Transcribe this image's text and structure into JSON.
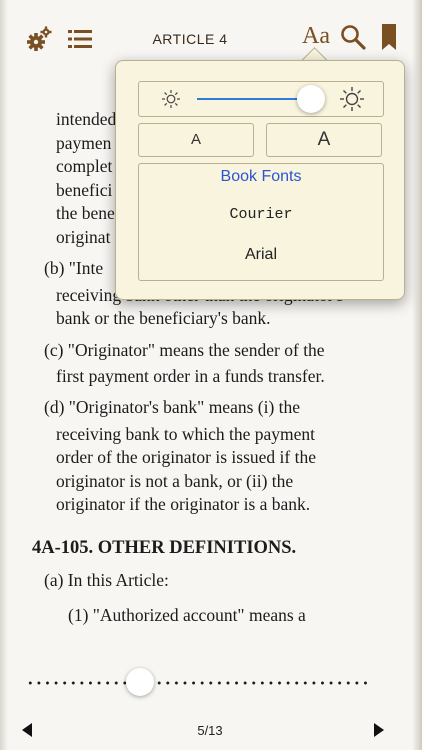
{
  "toolbar": {
    "title": "ARTICLE 4",
    "font_button_label": "Aa"
  },
  "content_lines": [
    "intended",
    "paymen",
    "complet",
    "benefici",
    "the bene",
    "originat",
    "(b)  \"Inte",
    "receiving bank other than the originator's",
    "bank or the beneficiary's bank.",
    "(c)  \"Originator\" means the sender of the",
    "first payment order in a funds transfer.",
    "(d)  \"Originator's bank\" means (i) the",
    "receiving bank to which the payment",
    "order of the originator is issued if the",
    "originator is not a bank, or (ii) the",
    "originator if the originator is a bank.",
    "4A-105. OTHER DEFINITIONS.",
    "(a)  In this Article:",
    "(1)  \"Authorized account\" means a"
  ],
  "popover": {
    "brightness_level": 0.88,
    "font_small_label": "A",
    "font_large_label": "A",
    "book_fonts_label": "Book Fonts",
    "font_options": [
      "Courier",
      "Arial"
    ]
  },
  "footer": {
    "page_indicator": "5/13",
    "scrubber_position": 0.33
  }
}
